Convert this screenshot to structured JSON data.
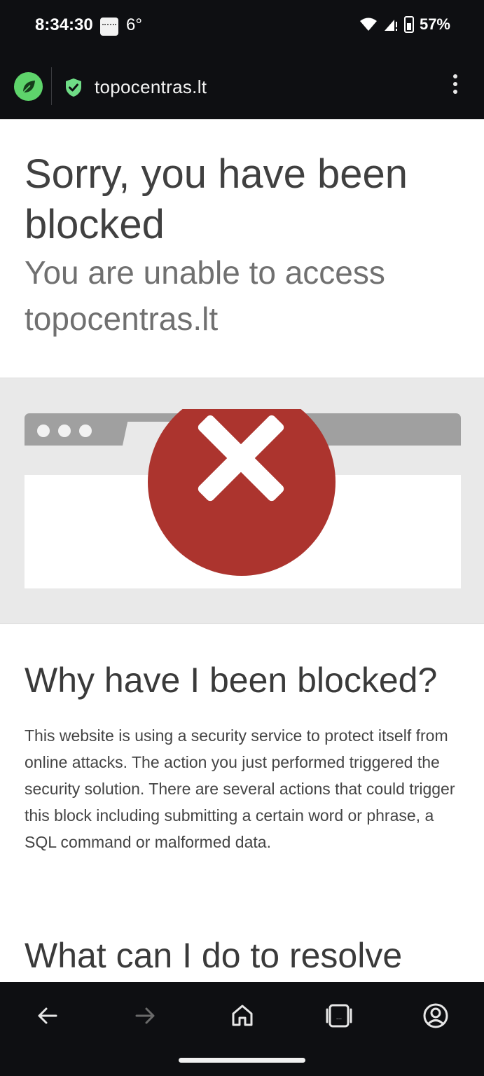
{
  "status_bar": {
    "time": "8:34:30",
    "weather_icon": "weather-app-icon",
    "temperature": "6°",
    "battery": "57%"
  },
  "toolbar": {
    "app_icon": "leaf-icon",
    "secure_icon": "shield-check-icon",
    "url": "topocentras.lt",
    "menu_icon": "more-vert-icon"
  },
  "page": {
    "headline": "Sorry, you have been blocked",
    "subheadline": "You are unable to access topocentras.lt",
    "why_title": "Why have I been blocked?",
    "why_body": "This website is using a security service to protect itself from online attacks. The action you just performed triggered the security solution. There are several actions that could trigger this block including submitting a certain word or phrase, a SQL command or malformed data.",
    "resolve_title": "What can I do to resolve"
  },
  "bottom_nav": {
    "back": "back-arrow-icon",
    "forward": "forward-arrow-icon",
    "home": "home-icon",
    "tabs": "tabs-icon",
    "account": "account-icon"
  },
  "colors": {
    "error_red": "#ac342e",
    "leaf_green": "#5ed46b",
    "chrome_dark": "#0e0f12"
  }
}
